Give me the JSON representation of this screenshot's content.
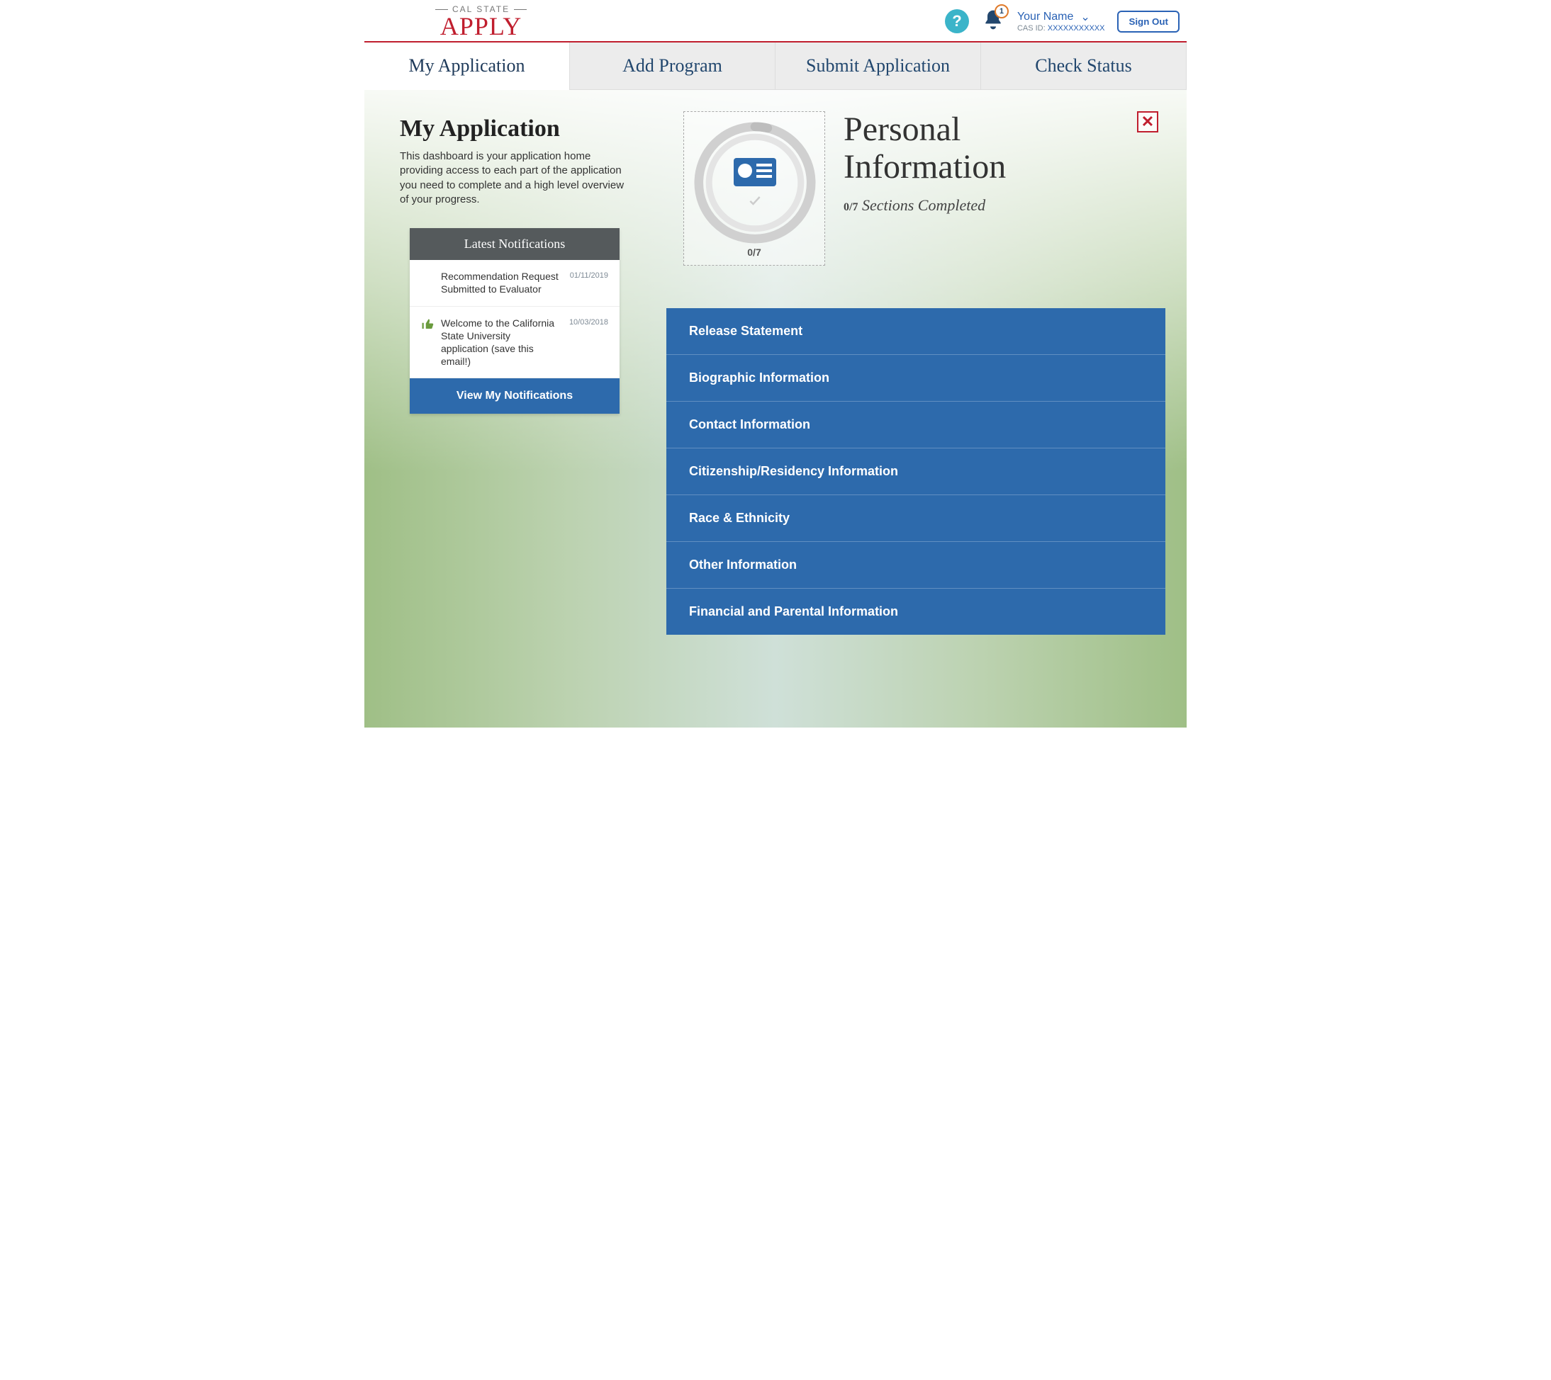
{
  "header": {
    "logo_top": "CAL STATE",
    "logo_bottom": "APPLY",
    "notification_count": "1",
    "user_name": "Your Name",
    "cas_label": "CAS ID:",
    "cas_id": "XXXXXXXXXXX",
    "sign_out": "Sign Out"
  },
  "tabs": [
    {
      "label": "My Application",
      "active": true
    },
    {
      "label": "Add Program",
      "active": false
    },
    {
      "label": "Submit Application",
      "active": false
    },
    {
      "label": "Check Status",
      "active": false
    }
  ],
  "left": {
    "title": "My Application",
    "description": "This dashboard is your application home providing access to each part of the application you need to complete and a high level overview of your progress.",
    "notif_header": "Latest Notifications",
    "notifications": [
      {
        "text": "Recommendation Request Submitted to Evaluator",
        "date": "01/11/2019",
        "thumbs": false
      },
      {
        "text": "Welcome to the California State University application (save this email!)",
        "date": "10/03/2018",
        "thumbs": true
      }
    ],
    "view_button": "View My Notifications"
  },
  "panel": {
    "title_line1": "Personal",
    "title_line2": "Information",
    "progress_label": "0/7",
    "sections_count": "0/7",
    "sections_text": "Sections Completed",
    "items": [
      "Release Statement",
      "Biographic Information",
      "Contact Information",
      "Citizenship/Residency Information",
      "Race & Ethnicity",
      "Other Information",
      "Financial and Parental Information"
    ]
  }
}
